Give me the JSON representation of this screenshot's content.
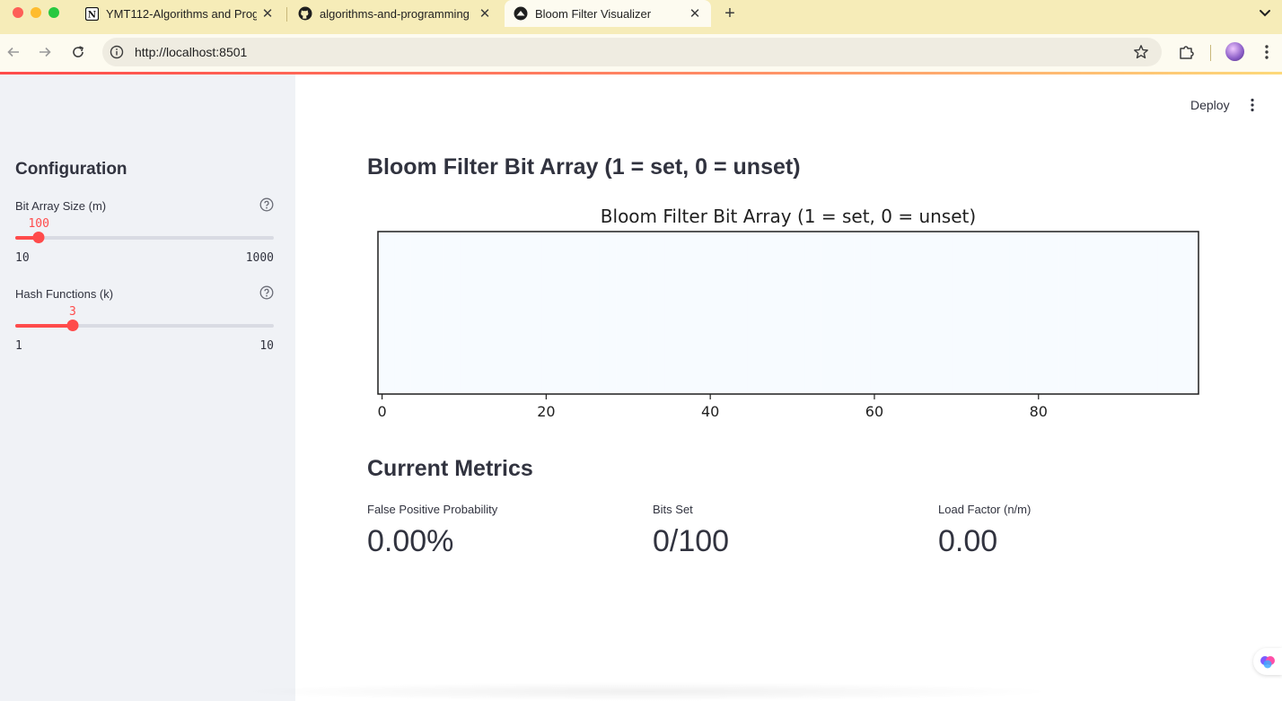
{
  "browser": {
    "tabs": [
      {
        "title": "YMT112-Algorithms and Prog",
        "favicon": "notion-icon"
      },
      {
        "title": "algorithms-and-programming",
        "favicon": "github-icon"
      },
      {
        "title": "Bloom Filter Visualizer",
        "favicon": "streamlit-icon",
        "active": true
      }
    ],
    "url": "http://localhost:8501"
  },
  "header": {
    "deploy_label": "Deploy"
  },
  "sidebar": {
    "heading": "Configuration",
    "sliders": [
      {
        "label": "Bit Array Size (m)",
        "value": "100",
        "min": "10",
        "max": "1000",
        "fraction": 0.091
      },
      {
        "label": "Hash Functions (k)",
        "value": "3",
        "min": "1",
        "max": "10",
        "fraction": 0.222
      }
    ]
  },
  "main": {
    "chart_heading": "Bloom Filter Bit Array (1 = set, 0 = unset)",
    "metrics_heading": "Current Metrics",
    "metrics": [
      {
        "label": "False Positive Probability",
        "value": "0.00%"
      },
      {
        "label": "Bits Set",
        "value": "0/100"
      },
      {
        "label": "Load Factor (n/m)",
        "value": "0.00"
      }
    ]
  },
  "chart_data": {
    "type": "heatmap",
    "title": "Bloom Filter Bit Array (1 = set, 0 = unset)",
    "x": [
      0,
      20,
      40,
      60,
      80
    ],
    "xlim": [
      -0.5,
      99.5
    ],
    "values": [
      [
        0,
        0,
        0,
        0,
        0,
        0,
        0,
        0,
        0,
        0,
        0,
        0,
        0,
        0,
        0,
        0,
        0,
        0,
        0,
        0,
        0,
        0,
        0,
        0,
        0,
        0,
        0,
        0,
        0,
        0,
        0,
        0,
        0,
        0,
        0,
        0,
        0,
        0,
        0,
        0,
        0,
        0,
        0,
        0,
        0,
        0,
        0,
        0,
        0,
        0,
        0,
        0,
        0,
        0,
        0,
        0,
        0,
        0,
        0,
        0,
        0,
        0,
        0,
        0,
        0,
        0,
        0,
        0,
        0,
        0,
        0,
        0,
        0,
        0,
        0,
        0,
        0,
        0,
        0,
        0,
        0,
        0,
        0,
        0,
        0,
        0,
        0,
        0,
        0,
        0,
        0,
        0,
        0,
        0,
        0,
        0,
        0,
        0,
        0,
        0
      ]
    ],
    "colormap": [
      "#f7fbff",
      "#08306b"
    ],
    "xlabel": "",
    "ylabel": ""
  },
  "colors": {
    "accent": "#ff4b4b",
    "sidebar_bg": "#f0f2f6",
    "text": "#31333f"
  }
}
